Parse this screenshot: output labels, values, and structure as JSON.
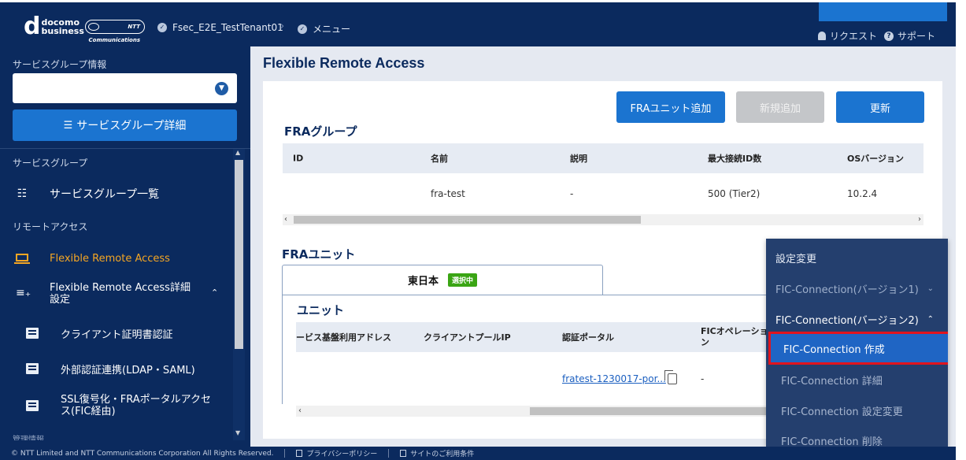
{
  "header": {
    "brand_mark": "d",
    "brand_line1": "docomo",
    "brand_line2": "business",
    "ntt_logo_text": "NTT Communications",
    "tenant": "Fsec_E2E_TestTenant01",
    "menu_crumb": "メニュー",
    "request_label": "リクエスト",
    "support_label": "サポート"
  },
  "sidebar": {
    "group_info_label": "サービスグループ情報",
    "group_select_value": "",
    "group_detail_button": "サービスグループ詳細",
    "section_service_group": "サービスグループ",
    "item_group_list": "サービスグループ一覧",
    "section_remote_access": "リモートアクセス",
    "item_fra": "Flexible Remote Access",
    "item_fra_detail": "Flexible Remote Access詳細設定",
    "sub_items": [
      {
        "label": "クライアント証明書認証"
      },
      {
        "label": "外部認証連携(LDAP・SAML)"
      },
      {
        "label": "SSL復号化・FRAポータルアクセス(FIC経由)"
      }
    ],
    "cut_label": "管理情報"
  },
  "main": {
    "page_title": "Flexible Remote Access",
    "buttons": {
      "add_unit": "FRAユニット追加",
      "new_add": "新規追加",
      "refresh": "更新"
    },
    "fra_group_title": "FRAグループ",
    "group_table": {
      "headers": [
        "ID",
        "名前",
        "説明",
        "最大接続ID数",
        "OSバージョン"
      ],
      "row": [
        "",
        "fra-test",
        "-",
        "500 (Tier2)",
        "10.2.4"
      ]
    },
    "fra_unit_title": "FRAユニット",
    "tab_label": "東日本",
    "tab_badge": "選択中",
    "unit_title": "ユニット",
    "unit_table": {
      "headers": [
        "ービス基盤利用アドレス",
        "クライアントプールIP",
        "認証ポータル",
        "FICオペレーション"
      ],
      "row": [
        "",
        "",
        "fratest-1230017-por...",
        "-"
      ]
    }
  },
  "menu": {
    "settings_change": "設定変更",
    "fic_v1": "FIC-Connection(バージョン1)",
    "fic_v2": "FIC-Connection(バージョン2)",
    "fic_create": "FIC-Connection 作成",
    "fic_detail": "FIC-Connection 詳細",
    "fic_settings_change": "FIC-Connection 設定変更",
    "fic_delete": "FIC-Connection 削除"
  },
  "footer": {
    "copyright": "© NTT Limited and NTT Communications Corporation All Rights Reserved.",
    "privacy": "プライバシーポリシー",
    "terms": "サイトのご利用条件"
  },
  "colors": {
    "navy": "#0b2a5e",
    "blue": "#1b74d0",
    "highlight_border": "#e0141e",
    "active_orange": "#f5a623"
  }
}
